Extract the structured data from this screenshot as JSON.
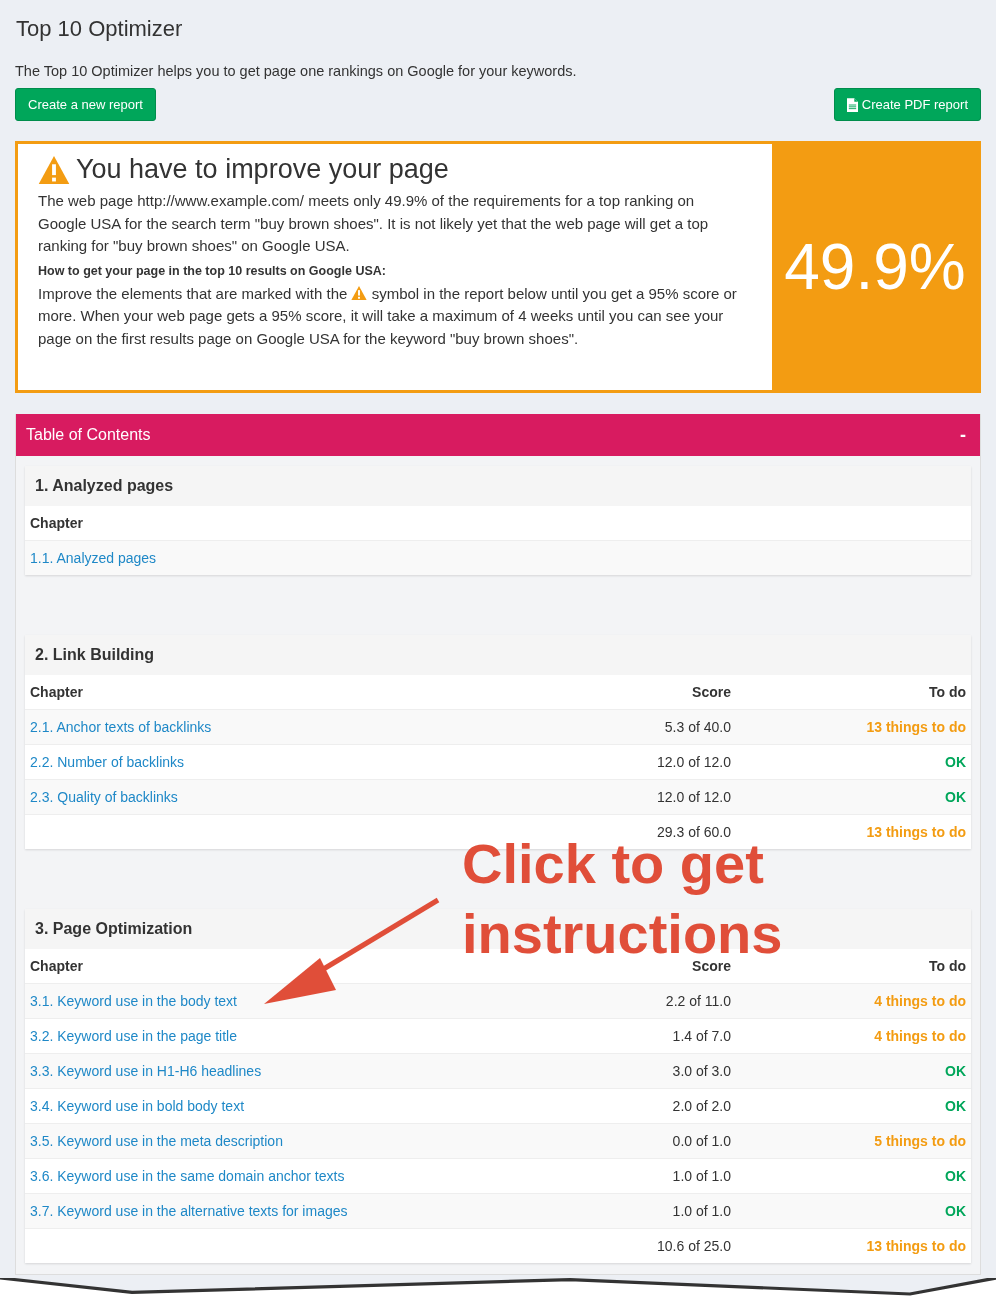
{
  "title": "Top 10 Optimizer",
  "intro": "The Top 10 Optimizer helps you to get page one rankings on Google for your keywords.",
  "buttons": {
    "new_report": "Create a new report",
    "pdf_report": "Create PDF report"
  },
  "alert": {
    "heading": "You have to improve your page",
    "summary": "The web page http://www.example.com/ meets only 49.9% of the requirements for a top ranking on Google USA for the search term \"buy brown shoes\". It is not likely yet that the web page will get a top ranking for \"buy brown shoes\" on Google USA.",
    "subheading": "How to get your page in the top 10 results on Google USA:",
    "instruction_before": "Improve the elements that are marked with the",
    "instruction_after": "symbol in the report below until you get a 95% score or more. When your web page gets a 95% score, it will take a maximum of 4 weeks until you can see your page on the first results page on Google USA for the keyword \"buy brown shoes\".",
    "score": "49.9%"
  },
  "toc": {
    "title": "Table of Contents",
    "toggle": "-",
    "sections": [
      {
        "title": "1. Analyzed pages",
        "columns": [
          "Chapter"
        ],
        "rows": [
          {
            "chapter": "1.1. Analyzed pages"
          }
        ]
      },
      {
        "title": "2. Link Building",
        "columns": [
          "Chapter",
          "Score",
          "To do"
        ],
        "rows": [
          {
            "chapter": "2.1. Anchor texts of backlinks",
            "score": "5.3 of 40.0",
            "todo": "13 things to do",
            "kind": "todo"
          },
          {
            "chapter": "2.2. Number of backlinks",
            "score": "12.0 of 12.0",
            "todo": "OK",
            "kind": "ok"
          },
          {
            "chapter": "2.3. Quality of backlinks",
            "score": "12.0 of 12.0",
            "todo": "OK",
            "kind": "ok"
          },
          {
            "score": "29.3 of 60.0",
            "todo": "13 things to do",
            "kind": "todo"
          }
        ]
      },
      {
        "title": "3. Page Optimization",
        "columns": [
          "Chapter",
          "Score",
          "To do"
        ],
        "rows": [
          {
            "chapter": "3.1. Keyword use in the body text",
            "score": "2.2 of 11.0",
            "todo": "4 things to do",
            "kind": "todo"
          },
          {
            "chapter": "3.2. Keyword use in the page title",
            "score": "1.4 of 7.0",
            "todo": "4 things to do",
            "kind": "todo"
          },
          {
            "chapter": "3.3. Keyword use in H1-H6 headlines",
            "score": "3.0 of 3.0",
            "todo": "OK",
            "kind": "ok"
          },
          {
            "chapter": "3.4. Keyword use in bold body text",
            "score": "2.0 of 2.0",
            "todo": "OK",
            "kind": "ok"
          },
          {
            "chapter": "3.5. Keyword use in the meta description",
            "score": "0.0 of 1.0",
            "todo": "5 things to do",
            "kind": "todo"
          },
          {
            "chapter": "3.6. Keyword use in the same domain anchor texts",
            "score": "1.0 of 1.0",
            "todo": "OK",
            "kind": "ok"
          },
          {
            "chapter": "3.7. Keyword use in the alternative texts for images",
            "score": "1.0 of 1.0",
            "todo": "OK",
            "kind": "ok"
          },
          {
            "score": "10.6 of 25.0",
            "todo": "13 things to do",
            "kind": "todo"
          }
        ]
      }
    ]
  },
  "annotation": [
    "Click to get",
    "instructions"
  ]
}
